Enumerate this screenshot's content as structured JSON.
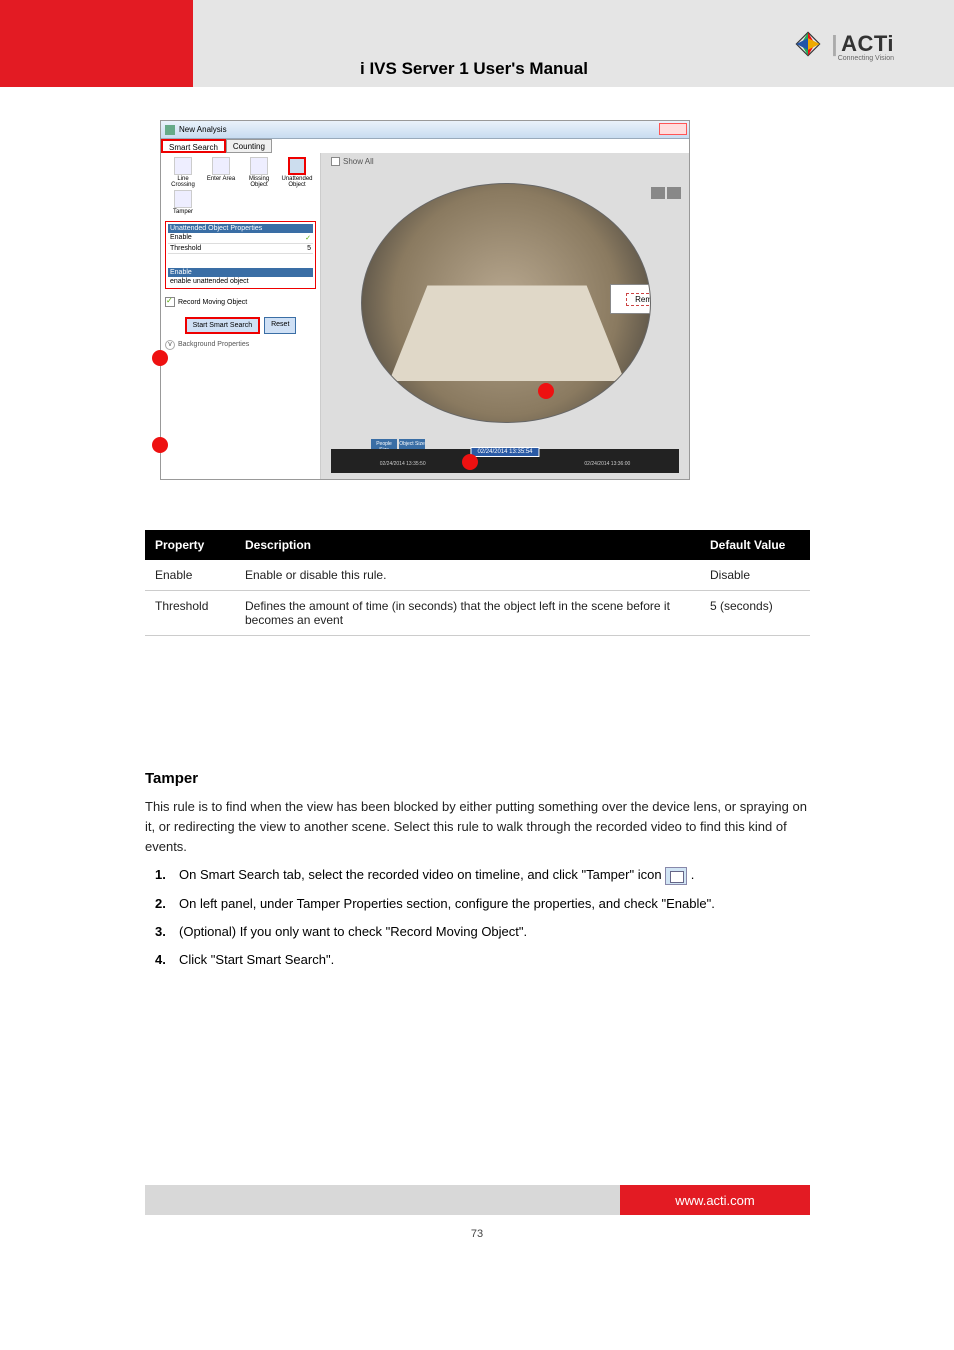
{
  "header": {
    "title": "i IVS Server 1 User's Manual",
    "logo_main": "ACTi",
    "logo_tag": "Connecting Vision"
  },
  "app": {
    "window_title": "New Analysis",
    "close": "",
    "tabs": {
      "smart": "Smart Search",
      "counting": "Counting"
    },
    "tools": {
      "line": "Line\nCrossing",
      "enter": "Enter Area",
      "missing": "Missing\nObject",
      "unattended": "Unattended\nObject",
      "tamper": "Tamper"
    },
    "props": {
      "title": "Unattended Object Properties",
      "enable": "Enable",
      "threshold": "Threshold",
      "threshold_val": "5",
      "enable2": "Enable",
      "enable2_desc": "enable unattended object"
    },
    "record": "Record Moving Object",
    "buttons": {
      "start": "Start Smart Search",
      "reset": "Reset"
    },
    "bg": "Background Properties",
    "right": {
      "showall": "Show All",
      "remove": "Remove",
      "people": "People\nSize",
      "object": "Object\nSize"
    },
    "timeline": {
      "center": "02/24/2014 13:35:54",
      "left": "02/24/2014 13:35:50",
      "right": "02/24/2014 13:36:00"
    }
  },
  "table": {
    "h1": "Property",
    "h2": "Description",
    "h3": "Default Value",
    "r1c1": "Enable",
    "r1c2": "Enable or disable this rule.",
    "r1c3": "Disable",
    "r2c1": "Threshold",
    "r2c2": "Defines the amount of time (in seconds) that the object left in the scene before it becomes an event",
    "r2c3": "5 (seconds)"
  },
  "sec": {
    "title": "Tamper",
    "intro": "This rule is to find when the view has been blocked by either putting something over the device lens, or spraying on it, or redirecting the view to another scene. Select this rule to walk through the recorded video to find this kind of events.",
    "s1a": "On ",
    "s1b": "Smart Search",
    "s1c": " tab, select the recorded video on timeline, and click \"",
    "s1d": "Tamper",
    "s1e": "\" icon ",
    "s1f": " .",
    "s2a": "On left panel, under ",
    "s2b": "Tamper Properties",
    "s2c": " section, configure the properties, and check \"",
    "s2d": "Enable",
    "s2e": "\".",
    "s3a": "(Optional) If you only want to check \"",
    "s3b": "Record Moving Object",
    "s3c": "\".",
    "s4a": "Click \"",
    "s4b": "Start Smart Search",
    "s4c": "\"."
  },
  "footer": {
    "link": "www.acti.com",
    "page": "73"
  }
}
